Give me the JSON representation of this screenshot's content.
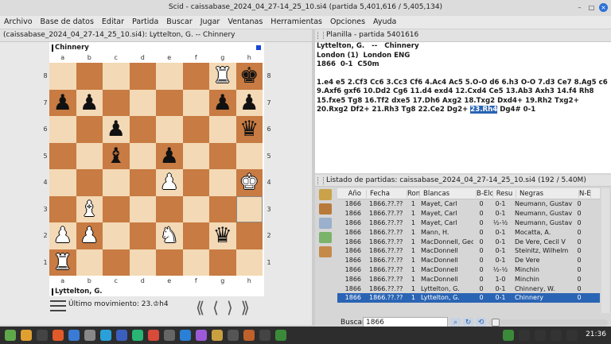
{
  "window": {
    "title": "Scid - caissabase_2024_04_27-14_25_10.si4 (partida 5,401,616 / 5,405,134)"
  },
  "menu": [
    "Archivo",
    "Base de datos",
    "Editar",
    "Partida",
    "Buscar",
    "Jugar",
    "Ventanas",
    "Herramientas",
    "Opciones",
    "Ayuda"
  ],
  "board_window": {
    "title": "(caissabase_2024_04_27-14_25_10.si4): Lyttelton, G. -- Chinnery",
    "black_player": "Chinnery",
    "white_player": "Lyttelton, G.",
    "last_move_label": "Último movimiento: 23.♔h4",
    "files": [
      "a",
      "b",
      "c",
      "d",
      "e",
      "f",
      "g",
      "h"
    ],
    "ranks": [
      "8",
      "7",
      "6",
      "5",
      "4",
      "3",
      "2",
      "1"
    ],
    "position": [
      [
        "",
        "",
        "",
        "",
        "",
        "",
        "wR",
        "bK"
      ],
      [
        "bP",
        "bP",
        "",
        "",
        "",
        "",
        "bP",
        "bP"
      ],
      [
        "",
        "",
        "bP",
        "",
        "",
        "",
        "",
        "bQ"
      ],
      [
        "",
        "",
        "bB",
        "",
        "bP",
        "",
        "",
        ""
      ],
      [
        "",
        "",
        "",
        "",
        "wP",
        "",
        "",
        "wK"
      ],
      [
        "",
        "wB",
        "",
        "",
        "",
        "",
        "",
        ""
      ],
      [
        "wP",
        "wP",
        "",
        "",
        "wN",
        "",
        "bQ",
        ""
      ],
      [
        "wR",
        "",
        "",
        "",
        "",
        "",
        "",
        ""
      ]
    ],
    "highlight": [
      "h3"
    ]
  },
  "pgn_window": {
    "title": "Planilla - partida 5401616",
    "header_line1": "Lyttelton, G.   --   Chinnery",
    "header_line2": "London (1)  London ENG",
    "header_line3": "1866  0-1  C50m",
    "moves_before": "1.e4 e5 2.Cf3 Cc6 3.Cc3 Cf6 4.Ac4 Ac5 5.O-O d6 6.h3 O-O 7.d3 Ce7 8.Ag5 c6 9.Axf6 gxf6 10.Dd2 Cg6 11.d4 exd4 12.Cxd4 Ce5 13.Ab3 Axh3 14.f4 Rh8 15.fxe5 Tg8 16.Tf2 dxe5 17.Dh6 Axg2 18.Txg2 Dxd4+ 19.Rh2 Txg2+ 20.Rxg2 Df2+ 21.Rh3 Tg8 22.Ce2 Dg2+",
    "current_move": "23.Rh4",
    "moves_after": "Dg4# 0-1"
  },
  "list_window": {
    "title": "Listado de partidas: caissabase_2024_04_27-14_25_10.si4 (192 / 5.40M)",
    "columns": [
      "Año",
      "Fecha",
      "Ron",
      "Blancas",
      "B-Elo",
      "Resu",
      "Negras",
      "N-E"
    ],
    "rows": [
      [
        "1866",
        "1866.??.??",
        "1",
        "Mayet, Carl",
        "0",
        "0-1",
        "Neumann, Gustav",
        "0"
      ],
      [
        "1866",
        "1866.??.??",
        "1",
        "Mayet, Carl",
        "0",
        "0-1",
        "Neumann, Gustav",
        "0"
      ],
      [
        "1866",
        "1866.??.??",
        "1",
        "Mayet, Carl",
        "0",
        "½-½",
        "Neumann, Gustav",
        "0"
      ],
      [
        "1866",
        "1866.??.??",
        "1",
        "Mann, H.",
        "0",
        "0-1",
        "Mocatta, A.",
        "0"
      ],
      [
        "1866",
        "1866.??.??",
        "1",
        "MacDonnell, Georg",
        "0",
        "0-1",
        "De Vere, Cecil V",
        "0"
      ],
      [
        "1866",
        "1866.??.??",
        "1",
        "MacDonnell",
        "0",
        "0-1",
        "Steinitz, Wilhelm",
        "0"
      ],
      [
        "1866",
        "1866.??.??",
        "1",
        "MacDonnell",
        "0",
        "0-1",
        "De Vere",
        "0"
      ],
      [
        "1866",
        "1866.??.??",
        "1",
        "MacDonnell",
        "0",
        "½-½",
        "Minchin",
        "0"
      ],
      [
        "1866",
        "1866.??.??",
        "1",
        "MacDonnell",
        "0",
        "1-0",
        "Minchin",
        "0"
      ],
      [
        "1866",
        "1866.??.??",
        "1",
        "Lyttelton, G.",
        "0",
        "0-1",
        "Chinnery, W.",
        "0"
      ],
      [
        "1866",
        "1866.??.??",
        "1",
        "Lyttelton, G.",
        "0",
        "0-1",
        "Chinnery",
        "0"
      ]
    ],
    "selected_row": 10,
    "search_label": "Buscar",
    "search_value": "1866"
  },
  "taskbar": {
    "clock": "21:36"
  }
}
